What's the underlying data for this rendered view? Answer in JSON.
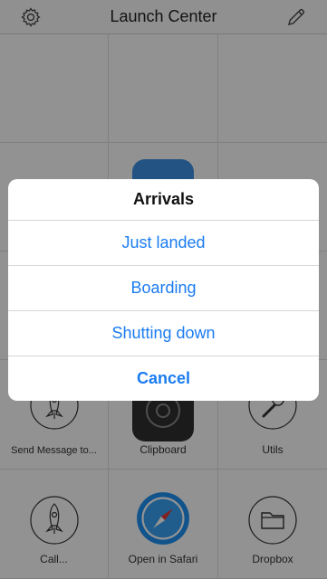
{
  "header": {
    "title": "Launch Center",
    "settings_icon": "gear-icon",
    "edit_icon": "pencil-icon"
  },
  "grid": {
    "labels": {
      "send_message": "Send Message to...",
      "clipboard": "Clipboard",
      "utils": "Utils",
      "call": "Call...",
      "open_in_safari": "Open in Safari",
      "dropbox": "Dropbox"
    }
  },
  "sheet": {
    "title": "Arrivals",
    "options": [
      "Just landed",
      "Boarding",
      "Shutting down"
    ],
    "cancel": "Cancel"
  },
  "colors": {
    "accent": "#1a7cf0",
    "overlay": "rgba(0,0,0,0.42)"
  }
}
